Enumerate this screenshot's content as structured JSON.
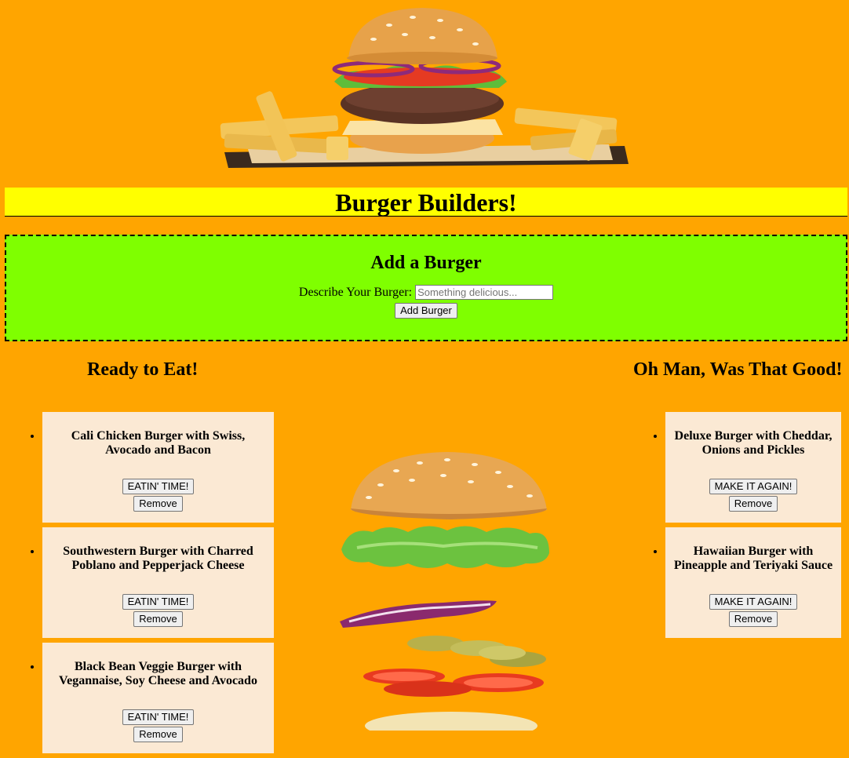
{
  "header": {
    "title": "Burger Builders!"
  },
  "add_form": {
    "heading": "Add a Burger",
    "label": "Describe Your Burger:",
    "placeholder": "Something delicious...",
    "submit_label": "Add Burger"
  },
  "ready": {
    "heading": "Ready to Eat!",
    "items": [
      {
        "name": "Cali Chicken Burger with Swiss, Avocado and Bacon",
        "action_label": "EATIN' TIME!",
        "remove_label": "Remove"
      },
      {
        "name": "Southwestern Burger with Charred Poblano and Pepperjack Cheese",
        "action_label": "EATIN' TIME!",
        "remove_label": "Remove"
      },
      {
        "name": "Black Bean Veggie Burger with Vegannaise, Soy Cheese and Avocado",
        "action_label": "EATIN' TIME!",
        "remove_label": "Remove"
      }
    ]
  },
  "eaten": {
    "heading": "Oh Man, Was That Good!",
    "items": [
      {
        "name": "Deluxe Burger with Cheddar, Onions and Pickles",
        "action_label": "MAKE IT AGAIN!",
        "remove_label": "Remove"
      },
      {
        "name": "Hawaiian Burger with Pineapple and Teriyaki Sauce",
        "action_label": "MAKE IT AGAIN!",
        "remove_label": "Remove"
      }
    ]
  },
  "colors": {
    "page_bg": "#ffa500",
    "title_bg": "#ffff00",
    "form_bg": "#7fff00",
    "card_bg": "#fbe9d4"
  }
}
